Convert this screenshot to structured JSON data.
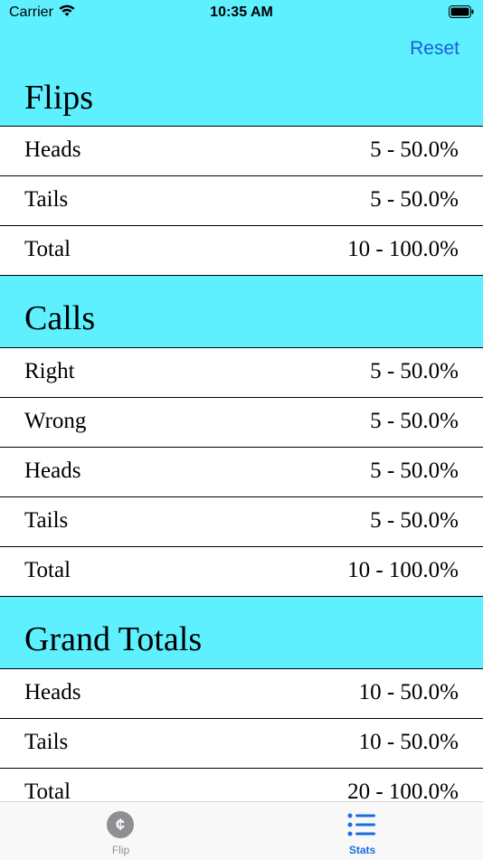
{
  "status_bar": {
    "carrier": "Carrier",
    "time": "10:35 AM"
  },
  "nav": {
    "reset_label": "Reset"
  },
  "colors": {
    "header_bg": "#5ef0ff",
    "accent": "#1a6fe0",
    "inactive": "#8e8e93"
  },
  "sections": [
    {
      "title": "Flips",
      "rows": [
        {
          "label": "Heads",
          "value": "5 - 50.0%"
        },
        {
          "label": "Tails",
          "value": "5 - 50.0%"
        },
        {
          "label": "Total",
          "value": "10 - 100.0%"
        }
      ]
    },
    {
      "title": "Calls",
      "rows": [
        {
          "label": "Right",
          "value": "5 - 50.0%"
        },
        {
          "label": "Wrong",
          "value": "5 - 50.0%"
        },
        {
          "label": "Heads",
          "value": "5 - 50.0%"
        },
        {
          "label": "Tails",
          "value": "5 - 50.0%"
        },
        {
          "label": "Total",
          "value": "10 - 100.0%"
        }
      ]
    },
    {
      "title": "Grand Totals",
      "rows": [
        {
          "label": "Heads",
          "value": "10 - 50.0%"
        },
        {
          "label": "Tails",
          "value": "10 - 50.0%"
        },
        {
          "label": "Total",
          "value": "20 - 100.0%"
        }
      ]
    }
  ],
  "tabbar": {
    "tabs": [
      {
        "label": "Flip",
        "icon": "coin-icon",
        "glyph": "¢",
        "selected": false
      },
      {
        "label": "Stats",
        "icon": "list-icon",
        "selected": true
      }
    ]
  }
}
